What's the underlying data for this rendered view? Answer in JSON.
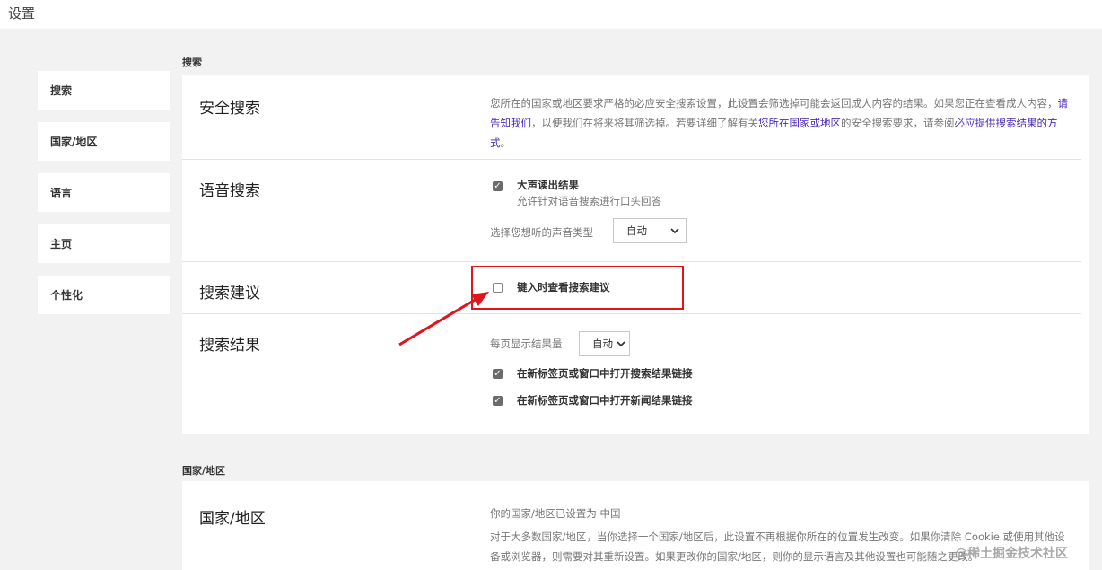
{
  "window_title": "设置",
  "sidebar": {
    "items": [
      {
        "label": "搜索"
      },
      {
        "label": "国家/地区"
      },
      {
        "label": "语言"
      },
      {
        "label": "主页"
      },
      {
        "label": "个性化"
      }
    ]
  },
  "search_section": {
    "heading": "搜索",
    "safe_search": {
      "title": "安全搜索",
      "desc_part1": "您所在的国家或地区要求严格的必应安全搜索设置，此设置会筛选掉可能会返回成人内容的结果。如果您正在查看成人内容，",
      "link_contact": "请告知我们",
      "desc_part2": "，以便我们在将来将其筛选掉。若要详细了解有关",
      "link_region": "您所在国家或地区",
      "desc_part3": "的安全搜索要求，请参阅",
      "link_provide": "必应提供搜索结果的方式",
      "desc_part4": "。"
    },
    "voice_search": {
      "title": "语音搜索",
      "read_aloud_label": "大声读出结果",
      "read_aloud_checked": true,
      "read_aloud_sub": "允许针对语音搜索进行口头回答",
      "voice_type_label": "选择您想听的声音类型",
      "voice_type_value": "自动"
    },
    "suggestions": {
      "title": "搜索建议",
      "checkbox_label": "键入时查看搜索建议",
      "checked": false
    },
    "results": {
      "title": "搜索结果",
      "per_page_label": "每页显示结果量",
      "per_page_value": "自动",
      "open_results_label": "在新标签页或窗口中打开搜索结果链接",
      "open_results_checked": true,
      "open_news_label": "在新标签页或窗口中打开新闻结果链接",
      "open_news_checked": true
    }
  },
  "region_section": {
    "heading": "国家/地区",
    "title": "国家/地区",
    "current": "你的国家/地区已设置为 中国",
    "desc": "对于大多数国家/地区，当你选择一个国家/地区后，此设置不再根据你所在的位置发生改变。如果你清除 Cookie 或使用其他设备或浏览器，则需要对其重新设置。如果更改你的国家/地区，则你的显示语言及其他设置也可能随之更改。"
  },
  "watermark": "@稀土掘金技术社区",
  "colors": {
    "highlight": "#e0141c",
    "link": "#4b2ab7",
    "background": "#f2f2f2"
  }
}
